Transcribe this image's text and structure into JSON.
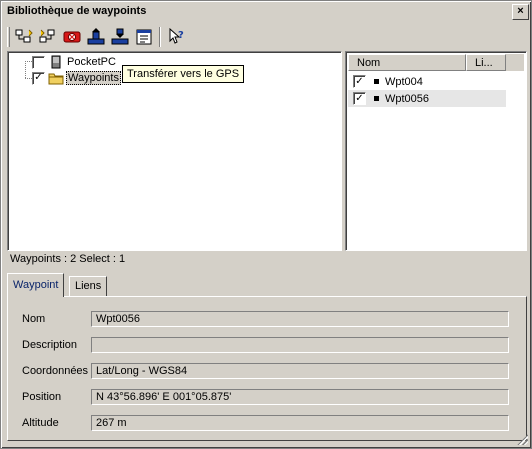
{
  "window": {
    "title": "Bibliothèque de waypoints",
    "close_label": "×"
  },
  "toolbar": {
    "buttons": [
      {
        "name": "tree-expand-icon"
      },
      {
        "name": "tree-collapse-icon"
      },
      {
        "name": "delete-icon"
      },
      {
        "name": "upload-to-gps-icon"
      },
      {
        "name": "download-from-gps-icon"
      },
      {
        "name": "properties-icon"
      },
      {
        "name": "help-pointer-icon"
      }
    ]
  },
  "tree": {
    "items": [
      {
        "label": "PocketPC",
        "checked": false,
        "icon": "pocketpc-icon"
      },
      {
        "label": "Waypoints",
        "checked": true,
        "icon": "folder-icon"
      }
    ],
    "tooltip": "Transférer vers le GPS"
  },
  "list": {
    "columns": [
      "Nom",
      "Li..."
    ],
    "rows": [
      {
        "name": "Wpt004",
        "checked": true
      },
      {
        "name": "Wpt0056",
        "checked": true
      }
    ]
  },
  "status": "Waypoints : 2 Select : 1",
  "tabs": [
    "Waypoint",
    "Liens"
  ],
  "details": {
    "nom_label": "Nom",
    "nom_value": "Wpt0056",
    "description_label": "Description",
    "description_value": "",
    "coordonnees_label": "Coordonnées",
    "coordonnees_value": "Lat/Long - WGS84",
    "position_label": "Position",
    "position_value": "N 43°56.896'  E 001°05.875'",
    "altitude_label": "Altitude",
    "altitude_value": "267 m"
  }
}
